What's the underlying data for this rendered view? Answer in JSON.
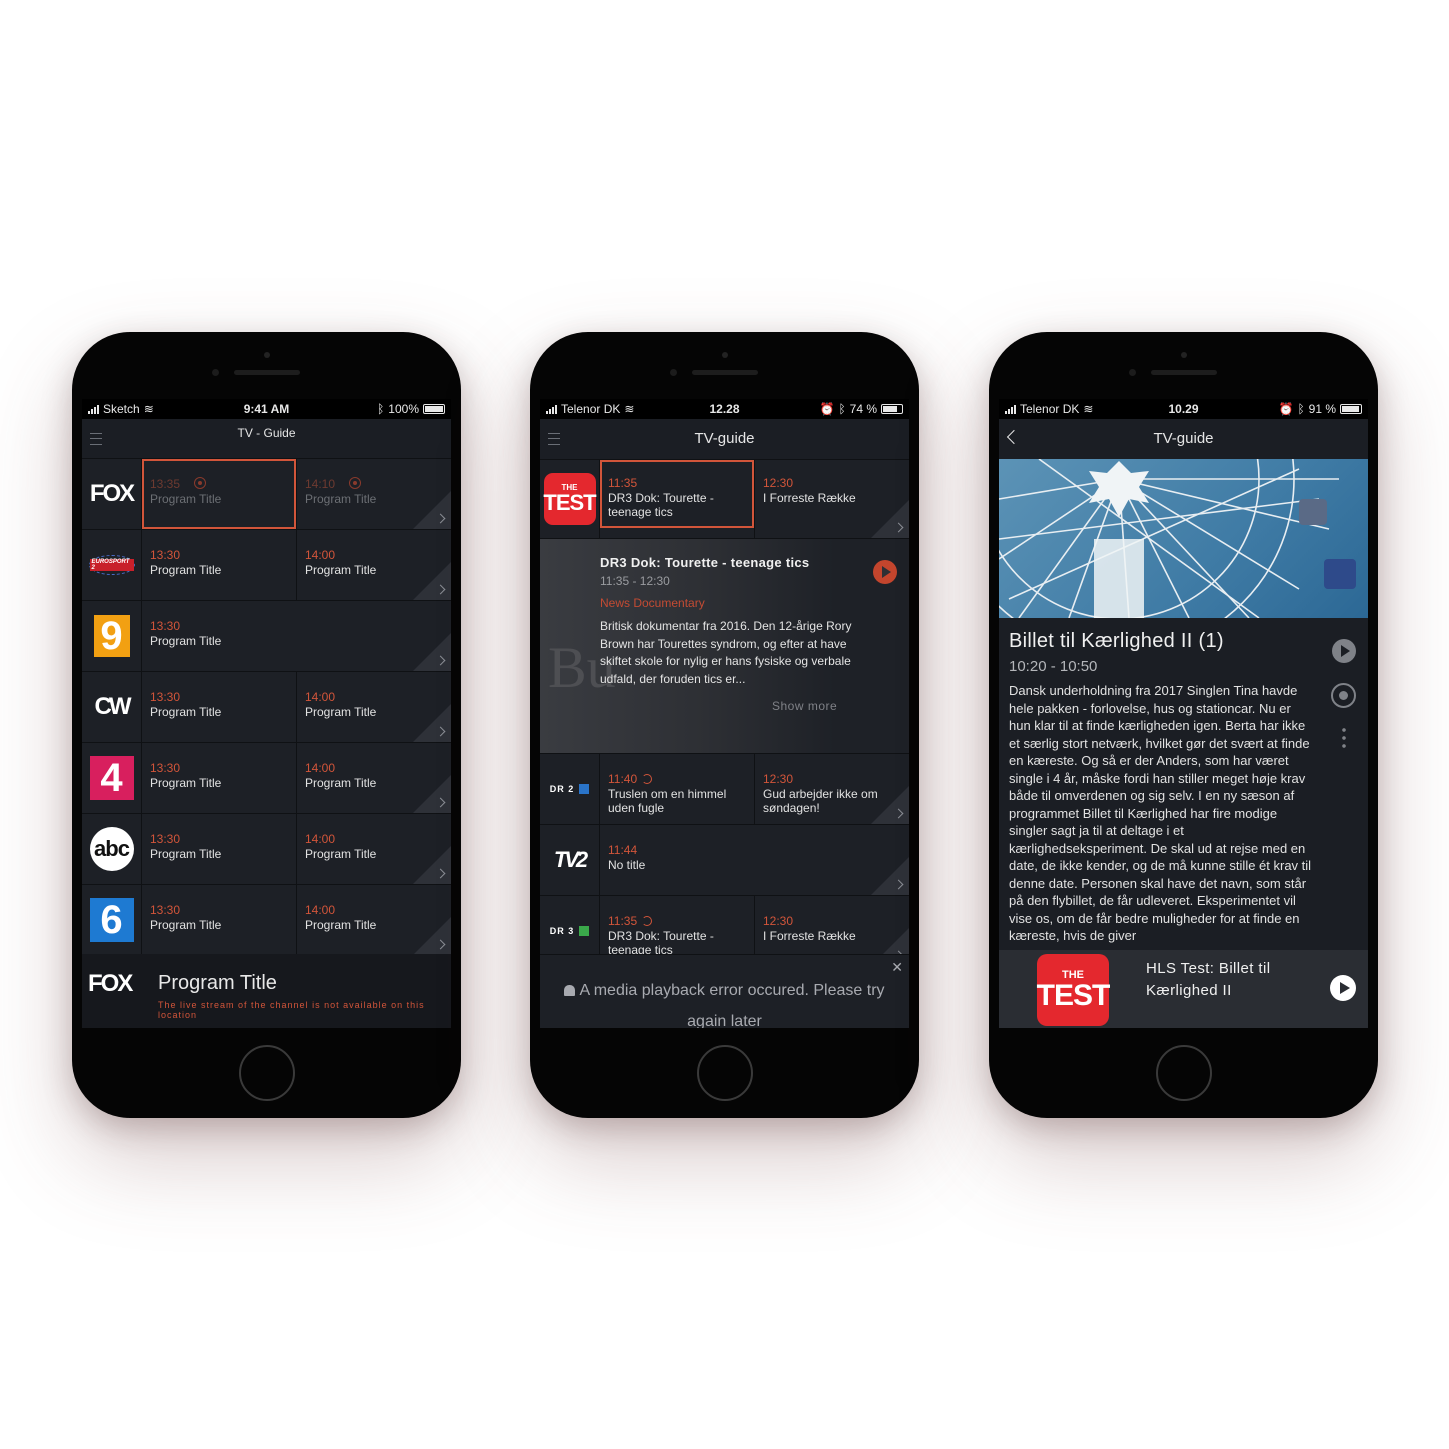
{
  "phone1": {
    "status": {
      "carrier": "Sketch",
      "time": "9:41 AM",
      "battery": "100%"
    },
    "title": "TV - Guide",
    "rows": [
      {
        "logo": "FOX",
        "cells": [
          {
            "time": "13:35",
            "name": "Program Title"
          },
          {
            "time": "14:10",
            "name": "Program Title"
          }
        ]
      },
      {
        "logo": "EUROSPORT 2",
        "cells": [
          {
            "time": "13:30",
            "name": "Program Title"
          },
          {
            "time": "14:00",
            "name": "Program Title"
          }
        ]
      },
      {
        "logo": "9",
        "cells": [
          {
            "time": "13:30",
            "name": "Program Title"
          }
        ]
      },
      {
        "logo": "CW",
        "cells": [
          {
            "time": "13:30",
            "name": "Program Title"
          },
          {
            "time": "14:00",
            "name": "Program Title"
          }
        ]
      },
      {
        "logo": "4",
        "cells": [
          {
            "time": "13:30",
            "name": "Program Title"
          },
          {
            "time": "14:00",
            "name": "Program Title"
          }
        ]
      },
      {
        "logo": "abc",
        "cells": [
          {
            "time": "13:30",
            "name": "Program Title"
          },
          {
            "time": "14:00",
            "name": "Program Title"
          }
        ]
      },
      {
        "logo": "6",
        "cells": [
          {
            "time": "13:30",
            "name": "Program Title"
          },
          {
            "time": "14:00",
            "name": "Program Title"
          }
        ]
      }
    ],
    "player": {
      "logo": "FOX",
      "title": "Program Title",
      "error": "The live stream of the channel is not available on this location"
    }
  },
  "phone2": {
    "status": {
      "carrier": "Telenor DK",
      "time": "12.28",
      "battery": "74 %"
    },
    "title": "TV-guide",
    "test_logo": {
      "top": "THE",
      "main": "TEST"
    },
    "row1": [
      {
        "time": "11:35",
        "name": "DR3 Dok: Tourette - teenage tics"
      },
      {
        "time": "12:30",
        "name": "I Forreste Række"
      }
    ],
    "detail": {
      "title": "DR3 Dok: Tourette - teenage tics",
      "time": "11:35 - 12:30",
      "genre": "News Documentary",
      "description": "Britisk dokumentar fra 2016. Den 12-årige Rory Brown har Tourettes syndrom, og efter at have skiftet skole for nylig er hans fysiske og verbale udfald, der foruden tics er...",
      "show_more": "Show more"
    },
    "row2": {
      "logo": "DR 2",
      "cells": [
        {
          "time": "11:40",
          "name": "Truslen om en himmel uden fugle"
        },
        {
          "time": "12:30",
          "name": "Gud arbejder ikke om søndagen!"
        }
      ]
    },
    "row3": {
      "logo": "TV2",
      "cells": [
        {
          "time": "11:44",
          "name": "No title"
        }
      ]
    },
    "row4": {
      "logo": "DR 3",
      "cells": [
        {
          "time": "11:35",
          "name": "DR3 Dok: Tourette - teenage tics"
        },
        {
          "time": "12:30",
          "name": "I Forreste Række"
        }
      ]
    },
    "error": "A media playback error occured. Please try again later"
  },
  "phone3": {
    "status": {
      "carrier": "Telenor DK",
      "time": "10.29",
      "battery": "91 %"
    },
    "title": "TV-guide",
    "program_title": "Billet til Kærlighed II (1)",
    "program_time": "10:20 - 10:50",
    "description": "Dansk underholdning fra 2017 Singlen Tina havde hele pakken - forlovelse, hus og stationcar. Nu er hun klar til at finde kærligheden igen. Berta har ikke et særlig stort netværk, hvilket gør det svært at finde en kæreste. Og så er der Anders, som har været single i 4 år, måske fordi han stiller meget høje krav både til omverdenen og sig selv. I en ny sæson af programmet Billet til Kærlighed har fire modige singler sagt ja til at deltage i et kærlighedseksperiment. De skal ud at rejse med en date, de ikke kender, og de må kunne stille ét krav til denne date. Personen skal have det navn, som står på den flybillet, de får udleveret. Eksperimentet vil vise os, om de får bedre muligheder for at finde en kæreste, hvis de giver",
    "mini_player": {
      "logo_top": "THE",
      "logo_main": "TEST",
      "title": "HLS Test: Billet til Kærlighed II"
    }
  },
  "colors": {
    "accent": "#d2553a",
    "background": "#1b1e24",
    "test_red": "#e4282e"
  }
}
